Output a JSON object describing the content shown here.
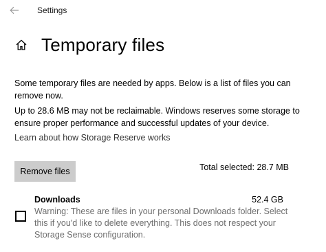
{
  "window": {
    "app_title": "Settings"
  },
  "page": {
    "title": "Temporary files"
  },
  "intro": {
    "paragraph_1": "Some temporary files are needed by apps. Below is a list of files you can remove now.",
    "paragraph_2": "Up to 28.6 MB may not be reclaimable. Windows reserves some storage to ensure proper performance and successful updates of your device.",
    "link": "Learn about how Storage Reserve works"
  },
  "actions": {
    "remove_label": "Remove files",
    "total_selected": "Total selected: 28.7 MB"
  },
  "items": [
    {
      "title": "Downloads",
      "size": "52.4 GB",
      "checked": false,
      "description": "Warning: These are files in your personal Downloads folder. Select this if you'd like to delete everything. This does not respect your Storage Sense configuration."
    }
  ],
  "icons": {
    "back": "back-arrow-icon",
    "home": "home-icon",
    "checkbox": "checkbox-unchecked"
  },
  "colors": {
    "button_bg": "#cccccc",
    "secondary_text": "#6e6e6e",
    "link_text": "#333333"
  }
}
